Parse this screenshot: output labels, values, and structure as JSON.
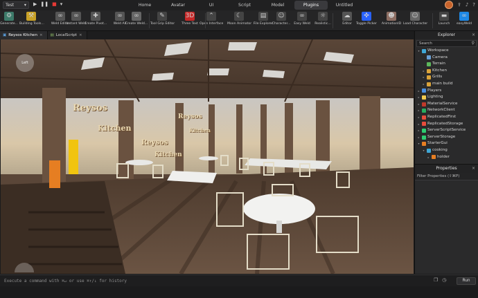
{
  "topbar": {
    "mode": "Test",
    "menu": [
      "Home",
      "Avatar",
      "UI",
      "Script",
      "Model",
      "Plugins",
      "Untitled"
    ],
    "active_menu": "Plugins"
  },
  "ribbon": {
    "items": [
      {
        "label": "Generate...",
        "icon": "gear-icon",
        "color": "#3d7b6a"
      },
      {
        "label": "Building Tools...",
        "icon": "tools-icon",
        "color": "#c9a227"
      },
      {
        "label": "Weld Editor",
        "icon": "weld-icon",
        "color": "#555"
      },
      {
        "label": "Instant Weld",
        "icon": "weld-icon",
        "color": "#555"
      },
      {
        "label": "Create Pivot...",
        "icon": "pivot-icon",
        "color": "#555"
      },
      {
        "label": "Weld All",
        "icon": "weld-icon",
        "color": "#555"
      },
      {
        "label": "Create Weld...",
        "icon": "weld-icon",
        "color": "#666"
      },
      {
        "label": "Tool Grip Editor",
        "icon": "grip-icon",
        "color": "#444"
      },
      {
        "label": "Three Text",
        "icon": "text-3d-icon",
        "color": "#c62828"
      },
      {
        "label": "Open Interface",
        "icon": "chevron-icon",
        "color": "#444"
      },
      {
        "label": "Moon Animator",
        "icon": "moon-icon",
        "color": "#444"
      },
      {
        "label": "File Explorer",
        "icon": "folder-icon",
        "color": "#444"
      },
      {
        "label": "Character...",
        "icon": "character-icon",
        "color": "#444"
      },
      {
        "label": "Easy Weld",
        "icon": "weld-icon",
        "color": "#444"
      },
      {
        "label": "Realistic...",
        "icon": "sun-icon",
        "color": "#444"
      },
      {
        "label": "Editor",
        "icon": "cloud-icon",
        "color": "#555"
      },
      {
        "label": "Toggle Picker",
        "icon": "picker-icon",
        "color": "#2962ff"
      },
      {
        "label": "AnimationID",
        "icon": "avatar-icon",
        "color": "#8d6e63"
      },
      {
        "label": "Load Character",
        "icon": "character-icon",
        "color": "#666"
      },
      {
        "label": "Launch",
        "icon": "launch-icon",
        "color": "#444"
      },
      {
        "label": "easyWeld",
        "icon": "weld-icon",
        "color": "#1e88e5"
      }
    ]
  },
  "doctabs": [
    {
      "label": "Reysos Kitchen",
      "active": true
    },
    {
      "label": "LocalScript",
      "active": false
    }
  ],
  "viewport": {
    "signs": [
      "Reysos",
      "Kitchen",
      "Reysos",
      "Kitchen",
      "Reysos",
      "Kitchen"
    ],
    "camera_label": "Left"
  },
  "explorer": {
    "title": "Explorer",
    "search_placeholder": "Search",
    "items": [
      {
        "label": "Workspace",
        "depth": 0,
        "icon": "#3fa7d6",
        "expanded": true
      },
      {
        "label": "Camera",
        "depth": 1,
        "icon": "#6a9fd4"
      },
      {
        "label": "Terrain",
        "depth": 1,
        "icon": "#5cb85c"
      },
      {
        "label": "Kitchen",
        "depth": 1,
        "icon": "#d9a33a",
        "expanded": false
      },
      {
        "label": "Grills",
        "depth": 1,
        "icon": "#d9a33a",
        "expanded": false
      },
      {
        "label": "main build",
        "depth": 1,
        "icon": "#d9a33a",
        "expanded": false
      },
      {
        "label": "Players",
        "depth": 0,
        "icon": "#4a90e2",
        "expanded": false
      },
      {
        "label": "Lighting",
        "depth": 0,
        "icon": "#f2c94c",
        "expanded": false
      },
      {
        "label": "MaterialService",
        "depth": 0,
        "icon": "#c0392b",
        "expanded": false
      },
      {
        "label": "NetworkClient",
        "depth": 0,
        "icon": "#27ae60",
        "expanded": false
      },
      {
        "label": "ReplicatedFirst",
        "depth": 0,
        "icon": "#e74c3c",
        "expanded": false
      },
      {
        "label": "ReplicatedStorage",
        "depth": 0,
        "icon": "#e74c3c",
        "expanded": false
      },
      {
        "label": "ServerScriptService",
        "depth": 0,
        "icon": "#2ecc71",
        "expanded": false
      },
      {
        "label": "ServerStorage",
        "depth": 0,
        "icon": "#2ecc71",
        "expanded": false
      },
      {
        "label": "StarterGui",
        "depth": 0,
        "icon": "#e67e22",
        "expanded": true
      },
      {
        "label": "cooking",
        "depth": 1,
        "icon": "#3fa7d6",
        "expanded": true
      },
      {
        "label": "holder",
        "depth": 2,
        "icon": "#e67e22",
        "expanded": false
      }
    ]
  },
  "properties": {
    "title": "Properties",
    "filter_placeholder": "Filter Properties (⇧⌘P)"
  },
  "command": {
    "placeholder": "Execute a command with ⌘↵ or use ⌘↑/↓ for history",
    "run_label": "Run"
  }
}
